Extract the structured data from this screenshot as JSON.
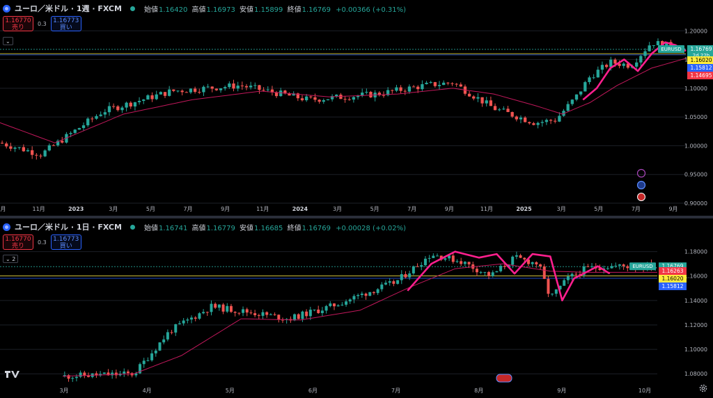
{
  "top_pane": {
    "title": "ユーロ／米ドル · 1週 · FXCM",
    "ohlc": {
      "open_label": "始値",
      "open": "1.16420",
      "high_label": "高値",
      "high": "1.16973",
      "low_label": "安値",
      "low": "1.15899",
      "close_label": "終値",
      "close": "1.16769",
      "change": "+0.00366 (+0.31%)"
    },
    "sell": {
      "price": "1.16770",
      "label": "売り"
    },
    "spread": "0.3",
    "buy": {
      "price": "1.16773",
      "label": "買い"
    },
    "collapse_label": "",
    "price_axis": [
      "1.20000",
      "1.15000",
      "1.10000",
      "1.05000",
      "1.00000",
      "0.95000",
      "0.90000"
    ],
    "time_axis": [
      "9月",
      "11月",
      "2023",
      "3月",
      "5月",
      "7月",
      "9月",
      "11月",
      "2024",
      "3月",
      "5月",
      "7月",
      "9月",
      "11月",
      "2025",
      "3月",
      "5月",
      "7月",
      "9月"
    ],
    "badges": [
      {
        "label": "EURUSD",
        "color": "#26a69a"
      },
      {
        "label": "1.16769",
        "sub": "2d 22h",
        "color": "#26a69a"
      },
      {
        "label": "1.16020",
        "color": "#ffeb3b"
      },
      {
        "label": "1.15812",
        "color": "#2962ff"
      },
      {
        "label": "1.14695",
        "color": "#f23645"
      }
    ]
  },
  "bottom_pane": {
    "title": "ユーロ／米ドル · 1日 · FXCM",
    "ohlc": {
      "open_label": "始値",
      "open": "1.16741",
      "high_label": "高値",
      "high": "1.16779",
      "low_label": "安値",
      "low": "1.16685",
      "close_label": "終値",
      "close": "1.16769",
      "change": "+0.00028 (+0.02%)"
    },
    "sell": {
      "price": "1.16770",
      "label": "売り"
    },
    "spread": "0.3",
    "buy": {
      "price": "1.16773",
      "label": "買い"
    },
    "collapse_label": "2",
    "price_axis": [
      "1.18000",
      "1.16000",
      "1.14000",
      "1.12000",
      "1.10000",
      "1.08000"
    ],
    "time_axis": [
      "3月",
      "4月",
      "5月",
      "6月",
      "7月",
      "8月",
      "9月",
      "10月"
    ],
    "badges": [
      {
        "label": "EURUSD",
        "color": "#26a69a"
      },
      {
        "label": "1.16769",
        "sub": "21:48:49",
        "color": "#26a69a"
      },
      {
        "label": "1.16263",
        "color": "#f23645"
      },
      {
        "label": "1.16020",
        "color": "#ffeb3b"
      },
      {
        "label": "1.15812",
        "color": "#2962ff"
      }
    ]
  },
  "colors": {
    "up": "#26a69a",
    "down": "#ef5350",
    "ma": "#c2185b",
    "trend": "#ff1f8e",
    "yellow": "#ffeb3b",
    "blue": "#2962ff",
    "grid": "#1c1f27"
  },
  "icons": [
    "symbol-icon",
    "lightning-icon",
    "refresh-icon",
    "us-flag-icon",
    "tradingview-logo",
    "gear-icon"
  ],
  "chart_data": [
    {
      "type": "candlestick",
      "interval": "1週",
      "ylim": [
        0.9,
        1.21
      ],
      "xlabel": "",
      "ylabel": "",
      "trend": [
        [
          0.0,
          1.005
        ],
        [
          0.06,
          0.985
        ],
        [
          0.15,
          1.06
        ],
        [
          0.25,
          1.095
        ],
        [
          0.35,
          1.105
        ],
        [
          0.45,
          1.08
        ],
        [
          0.55,
          1.09
        ],
        [
          0.62,
          1.105
        ],
        [
          0.66,
          1.11
        ],
        [
          0.72,
          1.065
        ],
        [
          0.78,
          1.04
        ],
        [
          0.81,
          1.045
        ],
        [
          0.84,
          1.085
        ],
        [
          0.86,
          1.12
        ],
        [
          0.89,
          1.145
        ],
        [
          0.92,
          1.14
        ],
        [
          0.95,
          1.18
        ],
        [
          0.97,
          1.175
        ],
        [
          1.0,
          1.168
        ]
      ],
      "ma": [
        [
          0.0,
          1.04
        ],
        [
          0.08,
          1.005
        ],
        [
          0.18,
          1.055
        ],
        [
          0.28,
          1.08
        ],
        [
          0.38,
          1.095
        ],
        [
          0.48,
          1.085
        ],
        [
          0.58,
          1.09
        ],
        [
          0.66,
          1.1
        ],
        [
          0.72,
          1.09
        ],
        [
          0.78,
          1.07
        ],
        [
          0.82,
          1.055
        ],
        [
          0.86,
          1.075
        ],
        [
          0.9,
          1.105
        ],
        [
          0.95,
          1.135
        ],
        [
          1.0,
          1.152
        ]
      ],
      "overlay": [
        [
          0.85,
          1.08
        ],
        [
          0.87,
          1.1
        ],
        [
          0.89,
          1.135
        ],
        [
          0.91,
          1.15
        ],
        [
          0.93,
          1.13
        ],
        [
          0.95,
          1.16
        ],
        [
          0.97,
          1.18
        ],
        [
          0.985,
          1.175
        ],
        [
          1.0,
          1.165
        ]
      ],
      "hlines": [
        {
          "y": 1.16769,
          "color": "#26a69a"
        },
        {
          "y": 1.1602,
          "color": "#ffeb3b"
        },
        {
          "y": 1.15812,
          "color": "#2962ff"
        }
      ]
    },
    {
      "type": "candlestick",
      "interval": "1日",
      "ylim": [
        1.075,
        1.19
      ],
      "xlabel": "",
      "ylabel": "",
      "trend": [
        [
          0.0,
          1.078
        ],
        [
          0.12,
          1.08
        ],
        [
          0.18,
          1.115
        ],
        [
          0.25,
          1.135
        ],
        [
          0.32,
          1.13
        ],
        [
          0.38,
          1.125
        ],
        [
          0.45,
          1.135
        ],
        [
          0.52,
          1.148
        ],
        [
          0.56,
          1.155
        ],
        [
          0.62,
          1.178
        ],
        [
          0.67,
          1.172
        ],
        [
          0.72,
          1.16
        ],
        [
          0.76,
          1.175
        ],
        [
          0.8,
          1.17
        ],
        [
          0.82,
          1.142
        ],
        [
          0.85,
          1.158
        ],
        [
          0.88,
          1.166
        ],
        [
          0.91,
          1.168
        ],
        [
          1.0,
          1.168
        ]
      ],
      "ma": [
        [
          0.0,
          1.078
        ],
        [
          0.12,
          1.08
        ],
        [
          0.2,
          1.095
        ],
        [
          0.3,
          1.125
        ],
        [
          0.4,
          1.124
        ],
        [
          0.5,
          1.132
        ],
        [
          0.58,
          1.15
        ],
        [
          0.66,
          1.166
        ],
        [
          0.74,
          1.17
        ],
        [
          0.82,
          1.164
        ],
        [
          0.88,
          1.163
        ],
        [
          1.0,
          1.163
        ]
      ],
      "overlay": [
        [
          0.58,
          1.148
        ],
        [
          0.62,
          1.17
        ],
        [
          0.66,
          1.18
        ],
        [
          0.7,
          1.175
        ],
        [
          0.73,
          1.178
        ],
        [
          0.76,
          1.162
        ],
        [
          0.79,
          1.178
        ],
        [
          0.82,
          1.176
        ],
        [
          0.84,
          1.14
        ],
        [
          0.86,
          1.158
        ],
        [
          0.88,
          1.163
        ],
        [
          0.9,
          1.168
        ],
        [
          0.92,
          1.162
        ]
      ],
      "hlines": [
        {
          "y": 1.16769,
          "color": "#26a69a"
        },
        {
          "y": 1.1602,
          "color": "#ffeb3b"
        },
        {
          "y": 1.15812,
          "color": "#2962ff"
        }
      ]
    }
  ]
}
